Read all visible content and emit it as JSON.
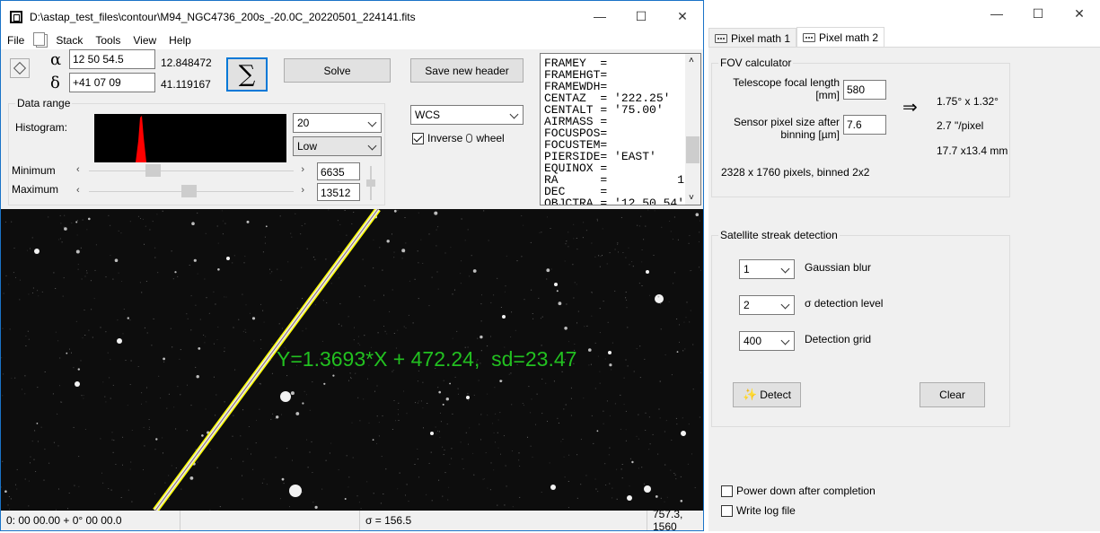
{
  "main_window": {
    "title": "D:\\astap_test_files\\contour\\M94_NGC4736_200s_-20.0C_20220501_224141.fits",
    "menu": [
      "File",
      "Stack",
      "Tools",
      "View",
      "Help"
    ]
  },
  "coords": {
    "alpha_symbol": "α",
    "delta_symbol": "δ",
    "ra_input": "12 50 54.5",
    "dec_input": "+41 07 09",
    "ra_decimal": "12.848472",
    "dec_decimal": "41.119167"
  },
  "buttons": {
    "sigma": "∑",
    "solve": "Solve",
    "save_header": "Save new header",
    "detect": "Detect",
    "clear": "Clear"
  },
  "data_range": {
    "title": "Data range",
    "histogram_label": "Histogram:",
    "minimum_label": "Minimum",
    "maximum_label": "Maximum",
    "minimum_value": "6635",
    "maximum_value": "13512",
    "range_combo": "20",
    "range_mode": "Low",
    "minimum_position": 0.3,
    "maximum_position": 0.49
  },
  "wcs": {
    "mode": "WCS",
    "inverse_label": "Inverse",
    "wheel_label": "wheel",
    "inverse_checked": true
  },
  "header_lines": [
    "FRAMEY  =",
    "FRAMEHGT=",
    "FRAMEWDH=",
    "CENTAZ  = '222.25'",
    "CENTALT = '75.00'",
    "AIRMASS =",
    "FOCUSPOS=",
    "FOCUSTEM=",
    "PIERSIDE= 'EAST'",
    "EQUINOX =",
    "RA      =          1",
    "DEC     =",
    "OBJCTRA = '12 50 54'"
  ],
  "image": {
    "overlay_text": "Y=1.3693*X + 472.24,  sd=23.47",
    "overlay_color": "#22c020",
    "streak_outline_color": "#ffff00"
  },
  "status": {
    "coords": "0: 00  00.00   + 0° 00  00.0",
    "empty": "",
    "sigma": "σ = 156.5",
    "position": "757.3, 1560"
  },
  "pixel_math": {
    "tabs": [
      "Pixel math 1",
      "Pixel math 2"
    ],
    "active_tab": 1,
    "fov": {
      "title": "FOV calculator",
      "focal_label": "Telescope focal length\n[mm]",
      "focal_value": "580",
      "pixel_label": "Sensor pixel size after\nbinning [µm]",
      "pixel_value": "7.6",
      "arrow": "⇒",
      "fov_result": "1.75° x 1.32°",
      "scale_result": "2.7 \"/pixel",
      "size_result": "17.7 x13.4 mm",
      "sensor_info": "2328 x 1760 pixels, binned 2x2"
    },
    "streak": {
      "title": "Satellite streak detection",
      "blur_value": "1",
      "blur_label": "Gaussian blur",
      "sigma_value": "2",
      "sigma_label": "σ detection level",
      "grid_value": "400",
      "grid_label": "Detection grid"
    },
    "power_down_label": "Power down after completion",
    "write_log_label": "Write log file"
  }
}
